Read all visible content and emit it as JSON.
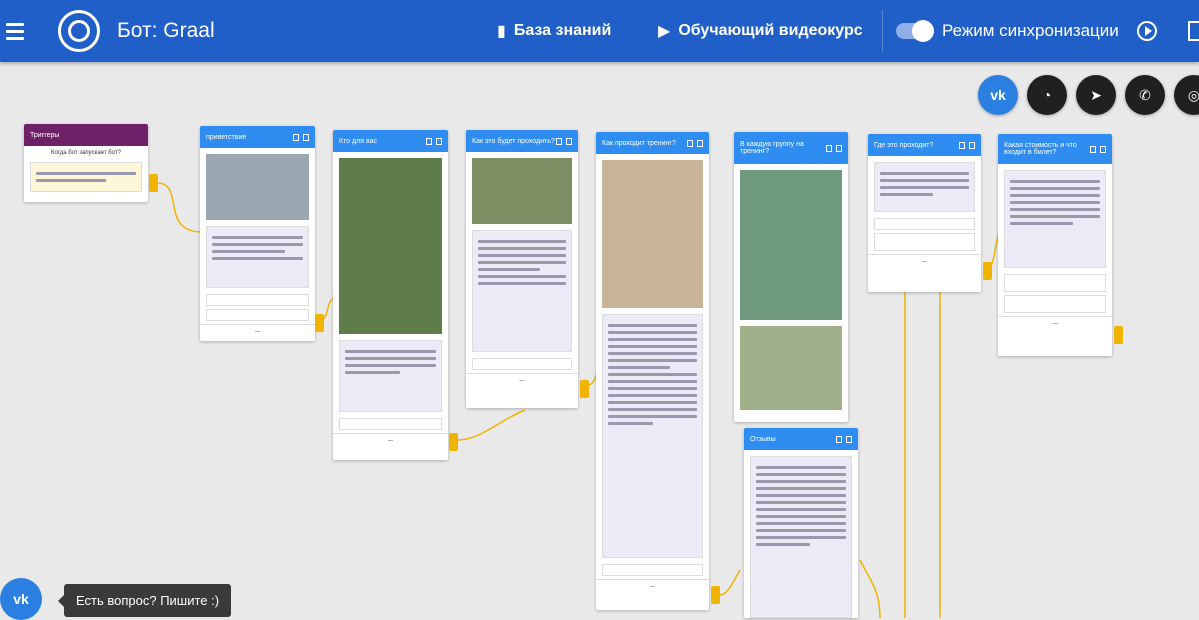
{
  "header": {
    "bot_title": "Бот: Graal",
    "knowledge_base": "База знаний",
    "video_course": "Обучающий видеокурс",
    "sync_mode": "Режим синхронизации"
  },
  "social": [
    "vk-icon",
    "messenger-icon",
    "telegram-icon",
    "viber-icon",
    "instagram-icon"
  ],
  "cards": {
    "triggers": {
      "title": "Триггеры",
      "line1": "Когда бот запускает бот?"
    },
    "c1": {
      "title": "приветствие"
    },
    "c2": {
      "title": "Кто для вас"
    },
    "c3": {
      "title": "Как это будет проходить?"
    },
    "c4": {
      "title": "Как проходит тренинг?"
    },
    "c5": {
      "title": "В каждую группу на тренинг?"
    },
    "c6": {
      "title": "Где это проходит?"
    },
    "c7": {
      "title": "Какая стоимость и что входит в билет?"
    },
    "c8": {
      "title": "Отзывы"
    }
  },
  "chat": {
    "tooltip": "Есть вопрос? Пишите :)"
  },
  "colors": {
    "header": "#1f5fc7",
    "card_header": "#2f8cf0",
    "trigger_header": "#6e2068",
    "handle": "#f0b400"
  }
}
